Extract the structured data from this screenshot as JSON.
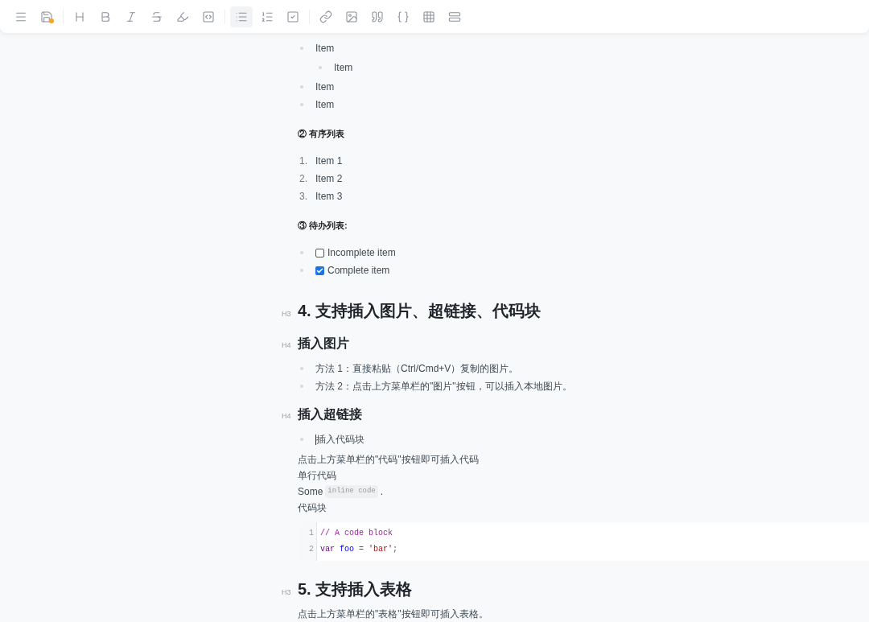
{
  "toolbar": {
    "buttons": [
      {
        "kind": "menu",
        "selected": false
      },
      {
        "kind": "save",
        "selected": false
      },
      {
        "kind": "divider"
      },
      {
        "kind": "heading",
        "selected": false
      },
      {
        "kind": "bold",
        "selected": false
      },
      {
        "kind": "italic",
        "selected": false
      },
      {
        "kind": "strike",
        "selected": false
      },
      {
        "kind": "highlight",
        "selected": false
      },
      {
        "kind": "code",
        "selected": false
      },
      {
        "kind": "divider"
      },
      {
        "kind": "bullet",
        "selected": true
      },
      {
        "kind": "ordered",
        "selected": false
      },
      {
        "kind": "todo",
        "selected": false
      },
      {
        "kind": "divider"
      },
      {
        "kind": "link",
        "selected": false
      },
      {
        "kind": "image",
        "selected": false
      },
      {
        "kind": "quote",
        "selected": false
      },
      {
        "kind": "codeblock",
        "selected": false
      },
      {
        "kind": "table",
        "selected": false
      },
      {
        "kind": "rows",
        "selected": false
      }
    ]
  },
  "document": [
    {
      "kind": "bullets",
      "items": [
        {
          "text": "Item",
          "children": [
            {
              "text": "Item"
            }
          ]
        },
        {
          "text": "Item"
        },
        {
          "text": "Item"
        }
      ]
    },
    {
      "kind": "label",
      "text": "② 有序列表"
    },
    {
      "kind": "ordered",
      "items": [
        {
          "number": "1.",
          "text": "Item 1"
        },
        {
          "number": "2.",
          "text": "Item 2"
        },
        {
          "number": "3.",
          "text": "Item 3"
        }
      ]
    },
    {
      "kind": "label",
      "text": "③ 待办列表:"
    },
    {
      "kind": "todos",
      "items": [
        {
          "text": "Incomplete item",
          "checked": false
        },
        {
          "text": "Complete item",
          "checked": true
        }
      ]
    },
    {
      "kind": "h3",
      "marker": "H3",
      "text": "4. 支持插入图片、超链接、代码块"
    },
    {
      "kind": "h4",
      "marker": "H4",
      "text": "插入图片"
    },
    {
      "kind": "bullets",
      "items": [
        {
          "text": "方法 1：直接粘贴（Ctrl/Cmd+V）复制的图片。"
        },
        {
          "text": "方法 2：点击上方菜单栏的\"图片\"按钮，可以插入本地图片。"
        }
      ]
    },
    {
      "kind": "h4",
      "marker": "H4",
      "text": "插入超链接"
    },
    {
      "kind": "bullets",
      "items": [
        {
          "text": "插入代码块",
          "caret": true
        }
      ]
    },
    {
      "kind": "paragraph",
      "text": "点击上方菜单栏的\"代码\"按钮即可插入代码"
    },
    {
      "kind": "paragraph",
      "text": "单行代码"
    },
    {
      "kind": "inline",
      "before": "Some",
      "code": "inline code",
      "after": "."
    },
    {
      "kind": "paragraph",
      "text": "代码块"
    },
    {
      "kind": "codeblock",
      "lines": [
        {
          "number": "1",
          "tokens": [
            {
              "kind": "comment",
              "text": "// A code block"
            }
          ]
        },
        {
          "number": "2",
          "tokens": [
            {
              "kind": "keyword",
              "text": "var"
            },
            {
              "kind": "name",
              "text": " foo "
            },
            {
              "kind": "plain",
              "text": "= "
            },
            {
              "kind": "string",
              "text": "'bar'"
            },
            {
              "kind": "plain",
              "text": ";"
            }
          ]
        }
      ]
    },
    {
      "kind": "h3",
      "marker": "H3",
      "text": "5. 支持插入表格"
    },
    {
      "kind": "paragraph",
      "text": "点击上方菜单栏的\"表格\"按钮即可插入表格。"
    }
  ]
}
